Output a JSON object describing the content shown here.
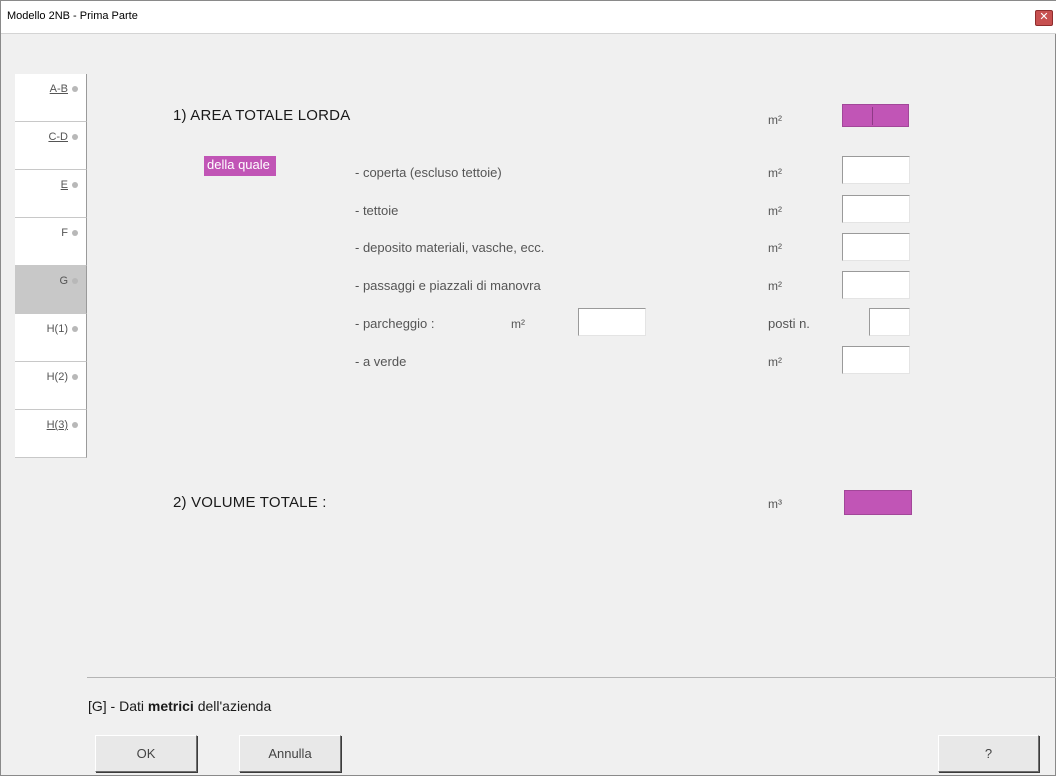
{
  "window": {
    "title": "Modello 2NB - Prima Parte",
    "close_glyph": "✕"
  },
  "tabs": [
    {
      "label": "A-B",
      "active": false,
      "underlined": true
    },
    {
      "label": "C-D",
      "active": false,
      "underlined": true
    },
    {
      "label": "E",
      "active": false,
      "underlined": true
    },
    {
      "label": "F",
      "active": false,
      "underlined": false
    },
    {
      "label": "G",
      "active": true,
      "underlined": false
    },
    {
      "label": "H(1)",
      "active": false,
      "underlined": false
    },
    {
      "label": "H(2)",
      "active": false,
      "underlined": false
    },
    {
      "label": "H(3)",
      "active": false,
      "underlined": true
    }
  ],
  "section1": {
    "title": "1)  AREA TOTALE LORDA",
    "unit": "m²",
    "badge": "della quale",
    "rows": [
      {
        "label": "- coperta (escluso tettoie)",
        "unit": "m²",
        "value": ""
      },
      {
        "label": "- tettoie",
        "unit": "m²",
        "value": ""
      },
      {
        "label": "- deposito materiali, vasche, ecc.",
        "unit": "m²",
        "value": ""
      },
      {
        "label": "- passaggi e piazzali di manovra",
        "unit": "m²",
        "value": ""
      }
    ],
    "parcheggio": {
      "label": "- parcheggio :",
      "unit": "m²",
      "value": "",
      "posti_label": "posti n.",
      "posti_value": ""
    },
    "verde": {
      "label": "- a verde",
      "unit": "m²",
      "value": ""
    }
  },
  "section2": {
    "title": "2)  VOLUME TOTALE :",
    "unit": "m³"
  },
  "footer": {
    "prefix": "[G] - Dati ",
    "bold": "metrici",
    "suffix": " dell'azienda"
  },
  "buttons": {
    "ok": "OK",
    "cancel": "Annulla",
    "help": "?"
  },
  "colors": {
    "accent": "#c155b6",
    "active_tab": "#c8c8c8",
    "background": "#f0f0f0"
  }
}
